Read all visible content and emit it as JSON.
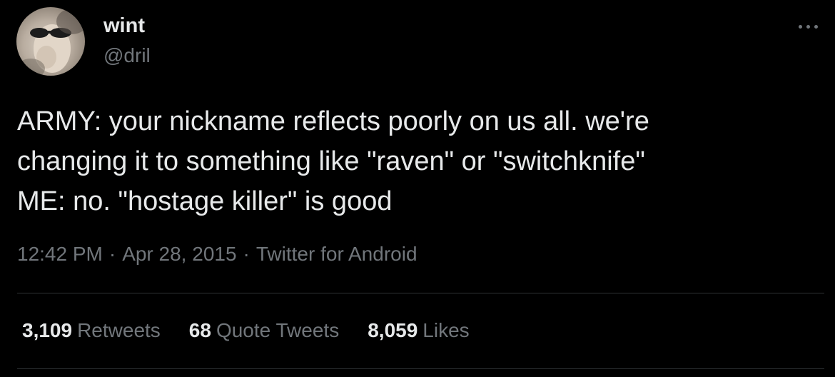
{
  "author": {
    "name": "wint",
    "handle": "@dril"
  },
  "tweet": {
    "text": "ARMY: your nickname reflects poorly on us all. we're\nchanging it to something like \"raven\" or \"switchknife\"\nME: no. \"hostage killer\" is good"
  },
  "meta": {
    "time": "12:42 PM",
    "separator": "·",
    "date": "Apr 28, 2015",
    "source": "Twitter for Android"
  },
  "stats": {
    "retweets": {
      "count": "3,109",
      "label": "Retweets"
    },
    "quote_tweets": {
      "count": "68",
      "label": "Quote Tweets"
    },
    "likes": {
      "count": "8,059",
      "label": "Likes"
    }
  },
  "colors": {
    "background": "#000000",
    "primary_text": "#e7e9ea",
    "secondary_text": "#71767b",
    "divider": "#2f3336"
  },
  "icons": {
    "more": "more-horizontal-icon"
  }
}
